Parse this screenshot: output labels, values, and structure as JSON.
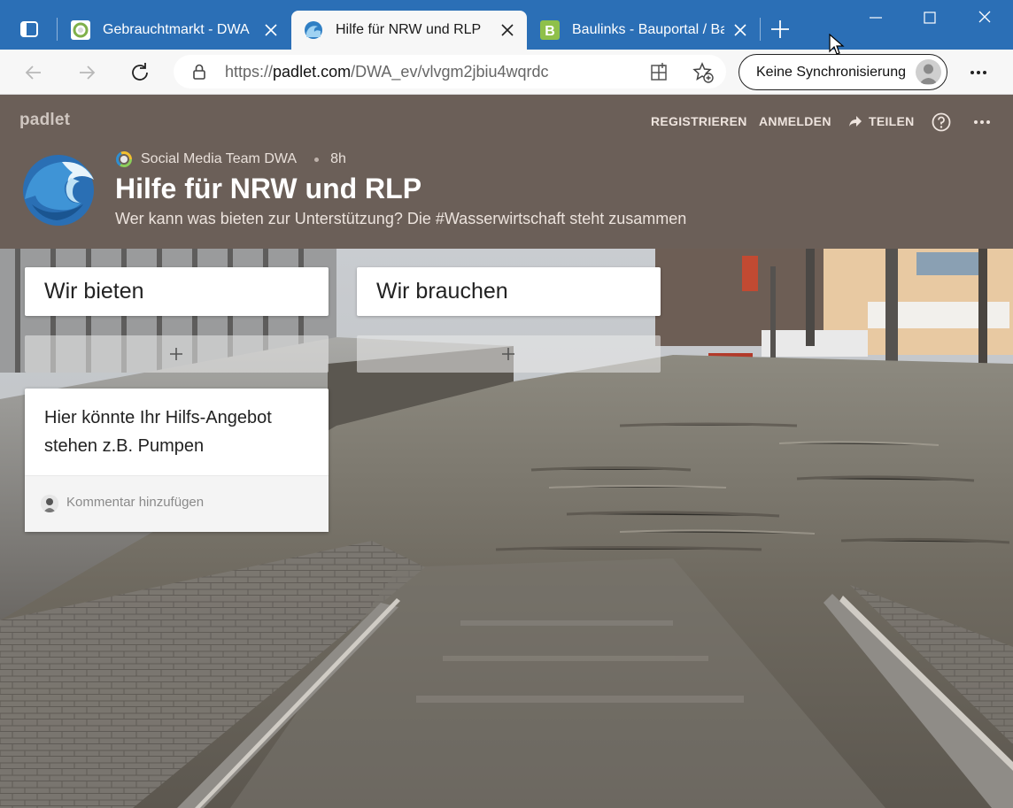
{
  "browser": {
    "tabs": [
      {
        "title": "Gebrauchtmarkt - DWA",
        "favicon": "gebrauchtmarkt-favicon",
        "active": false
      },
      {
        "title": "Hilfe für NRW und RLP",
        "favicon": "padlet-wave-favicon",
        "active": true
      },
      {
        "title": "Baulinks - Bauportal / Ba",
        "favicon": "baulinks-favicon",
        "active": false
      }
    ],
    "url_prefix": "https://",
    "url_domain": "padlet.com",
    "url_path": "/DWA_ev/vlvgm2jbiu4wqrdc",
    "sync_label": "Keine Synchronisierung",
    "accent": "#2b6fb6"
  },
  "padlet": {
    "logo": "padlet",
    "actions": {
      "register": "REGISTRIEREN",
      "login": "ANMELDEN",
      "share": "TEILEN"
    },
    "author": "Social Media Team DWA",
    "age": "8h",
    "title": "Hilfe für NRW und RLP",
    "description": "Wer kann was bieten zur Unterstützung? Die #Wasserwirtschaft steht zusammen",
    "header_color": "#6b5f58",
    "columns": [
      {
        "title": "Wir bieten"
      },
      {
        "title": "Wir brauchen"
      }
    ],
    "post": {
      "text": "Hier könnte Ihr Hilfs-Angebot stehen z.B. Pumpen",
      "comment_placeholder": "Kommentar hinzufügen"
    }
  }
}
